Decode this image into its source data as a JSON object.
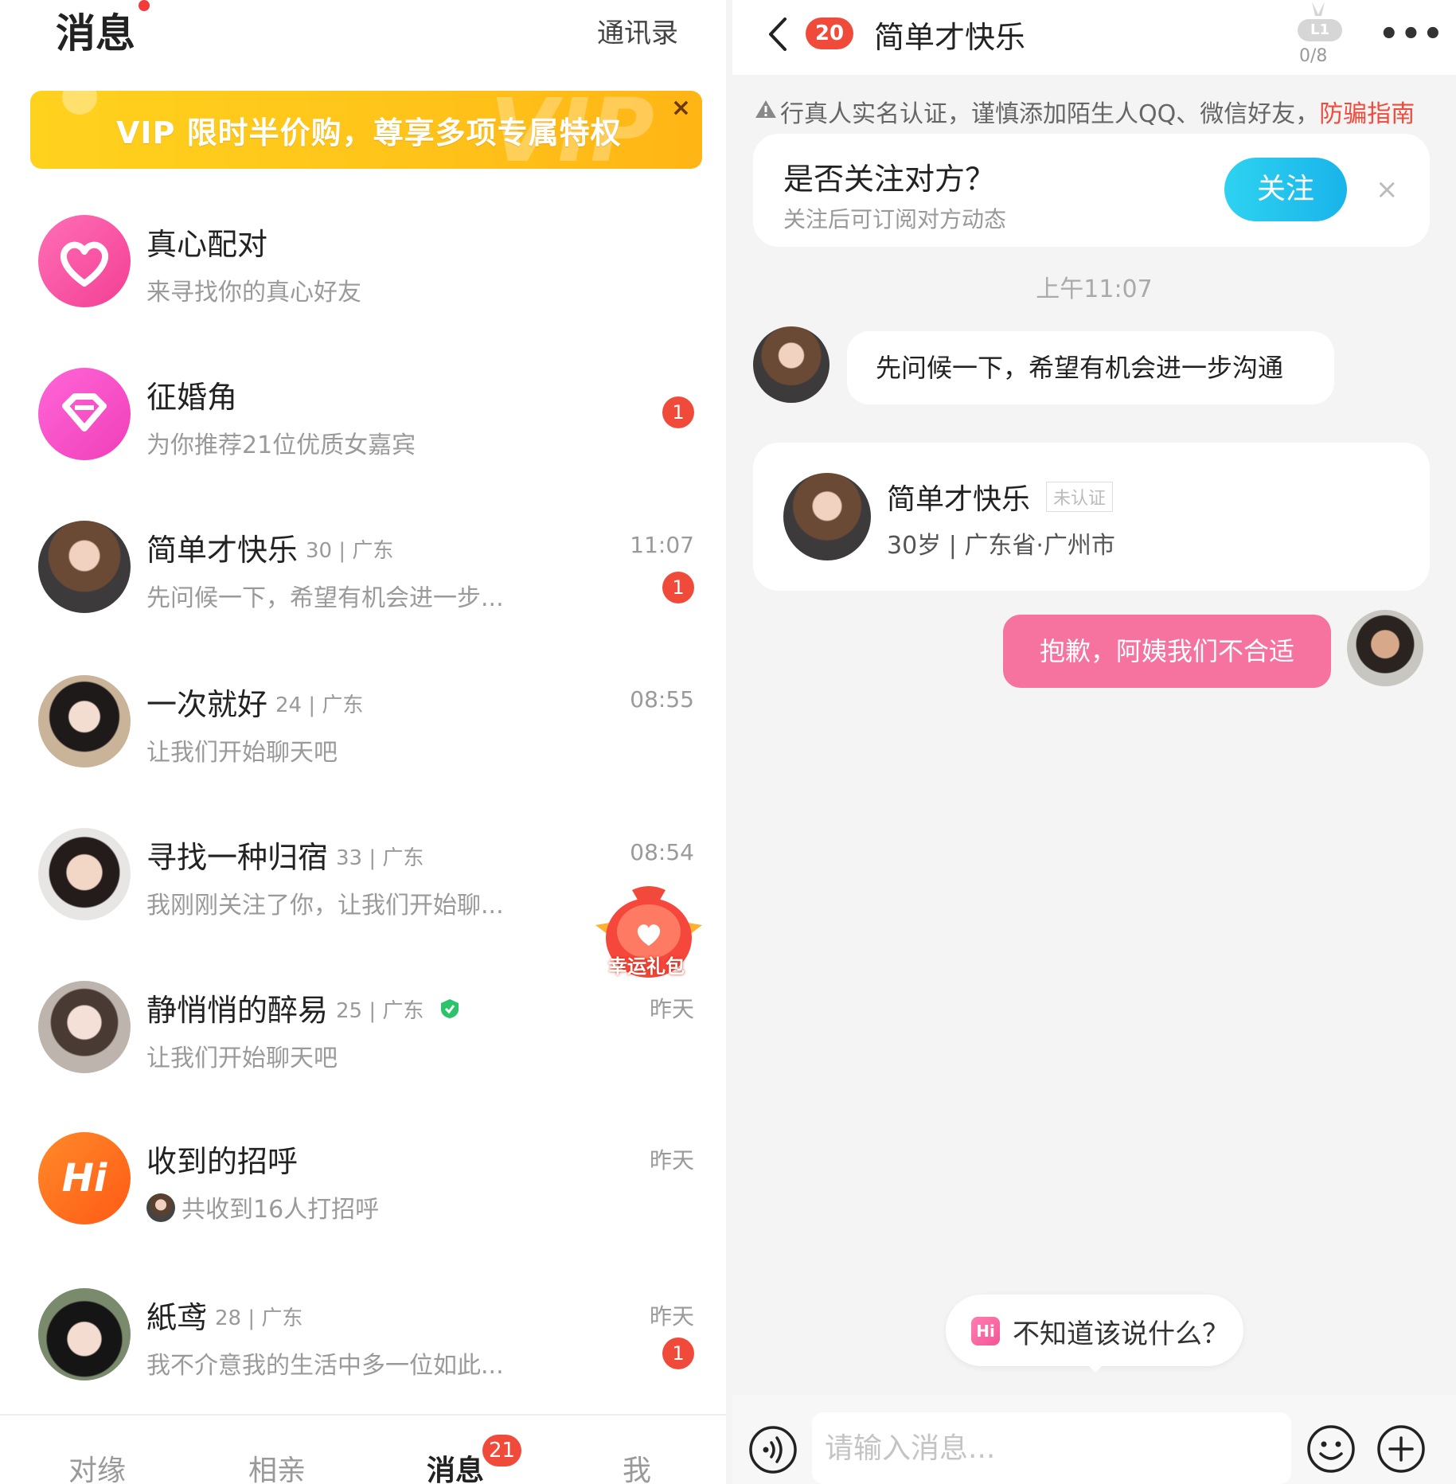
{
  "left": {
    "header": {
      "title": "消息",
      "contacts": "通讯录"
    },
    "vip_banner": {
      "text": "VIP 限时半价购，尊享多项专属特权",
      "watermark": "VIP",
      "close": "×"
    },
    "conversations": [
      {
        "name": "真心配对",
        "meta": "",
        "preview": "来寻找你的真心好友",
        "time": "",
        "badge": "",
        "avatar": "heart-icon",
        "color": "#f64fa2"
      },
      {
        "name": "征婚角",
        "meta": "",
        "preview": "为你推荐21位优质女嘉宾",
        "time": "",
        "badge": "1",
        "avatar": "diamond-icon",
        "color": "#f64fca"
      },
      {
        "name": "简单才快乐",
        "meta": "30 | 广东",
        "preview": "先问候一下，希望有机会进一步...",
        "time": "11:07",
        "badge": "1",
        "avatar": "user-avatar"
      },
      {
        "name": "一次就好",
        "meta": "24 | 广东",
        "preview": "让我们开始聊天吧",
        "time": "08:55",
        "badge": "",
        "avatar": "user-avatar"
      },
      {
        "name": "寻找一种归宿",
        "meta": "33 | 广东",
        "preview": "我刚刚关注了你，让我们开始聊...",
        "time": "08:54",
        "badge": "",
        "avatar": "user-avatar"
      },
      {
        "name": "静悄悄的醉易",
        "meta": "25 | 广东",
        "preview": "让我们开始聊天吧",
        "time": "昨天",
        "badge": "",
        "avatar": "user-avatar"
      },
      {
        "name": "收到的招呼",
        "meta": "",
        "preview": "共收到16人打招呼",
        "time": "昨天",
        "badge": "",
        "avatar": "hi-icon",
        "color": "#ff6a1c"
      },
      {
        "name": "紙鸢",
        "meta": "28 | 广东",
        "preview": "我不介意我的生活中多一位如此...",
        "time": "昨天",
        "badge": "1",
        "avatar": "user-avatar"
      }
    ],
    "gift": {
      "label": "幸运礼包"
    },
    "tabs": [
      {
        "label": "对缘"
      },
      {
        "label": "相亲"
      },
      {
        "label": "消息",
        "badge": "21"
      },
      {
        "label": "我"
      }
    ]
  },
  "right": {
    "header": {
      "unread": "20",
      "title": "简单才快乐",
      "level": "L1",
      "level_progress": "0/8",
      "more": "•••"
    },
    "notice": {
      "text": "行真人实名认证，谨慎添加陌生人QQ、微信好友，",
      "link": "防骗指南"
    },
    "follow_card": {
      "title": "是否关注对方？",
      "subtitle": "关注后可订阅对方动态",
      "button": "关注",
      "close": "×"
    },
    "timestamp": "上午11:07",
    "incoming_message": "先问候一下，希望有机会进一步沟通",
    "profile_card": {
      "name": "简单才快乐",
      "tag": "未认证",
      "info": "30岁 | 广东省·广州市"
    },
    "outgoing_message": "抱歉，阿姨我们不合适",
    "hint": {
      "icon": "Hi",
      "text": "不知道该说什么？"
    },
    "input": {
      "placeholder": "请输入消息..."
    }
  }
}
